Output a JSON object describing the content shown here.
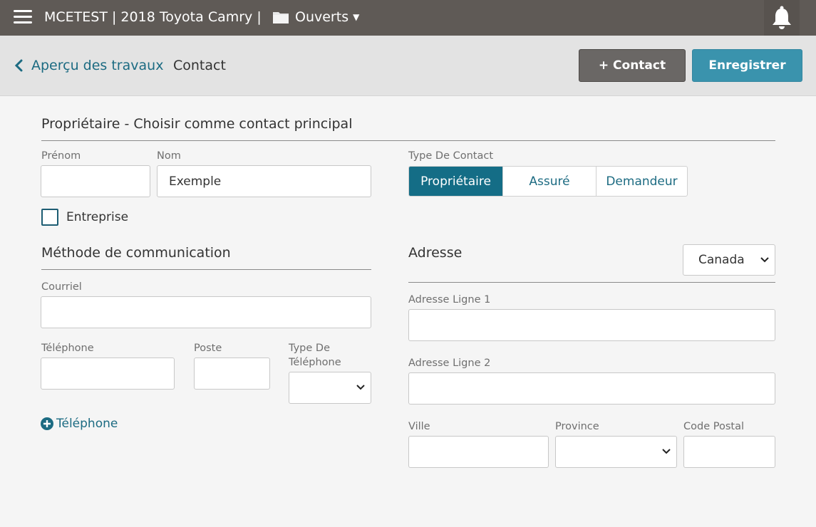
{
  "header": {
    "app_title": "MCETEST | 2018 Toyota Camry |",
    "folder_label": "Ouverts",
    "menu_icon": "hamburger-menu-icon",
    "bell_icon": "bell-icon"
  },
  "subheader": {
    "back_label": "Aperçu des travaux",
    "current_label": "Contact",
    "add_contact_label": "+ Contact",
    "save_label": "Enregistrer"
  },
  "owner_section": {
    "title": "Propriétaire - Choisir comme contact principal",
    "first_name_label": "Prénom",
    "first_name_value": "",
    "last_name_label": "Nom",
    "last_name_value": "Exemple",
    "company_label": "Entreprise",
    "company_checked": false,
    "contact_type_label": "Type De Contact",
    "contact_types": [
      "Propriétaire",
      "Assuré",
      "Demandeur"
    ],
    "selected_contact_type": "Propriétaire"
  },
  "communication": {
    "title": "Méthode de communication",
    "email_label": "Courriel",
    "email_value": "",
    "phone_label": "Téléphone",
    "extension_label": "Poste",
    "phone_type_label": "Type De Téléphone",
    "add_phone_label": "Téléphone"
  },
  "address": {
    "title": "Adresse",
    "country": "Canada",
    "line1_label": "Adresse Ligne 1",
    "line2_label": "Adresse Ligne 2",
    "city_label": "Ville",
    "province_label": "Province",
    "postal_code_label": "Code Postal"
  },
  "colors": {
    "topbar": "#5f5a56",
    "accent": "#146d86",
    "save_button": "#3a93ad",
    "link": "#1c6b82"
  }
}
